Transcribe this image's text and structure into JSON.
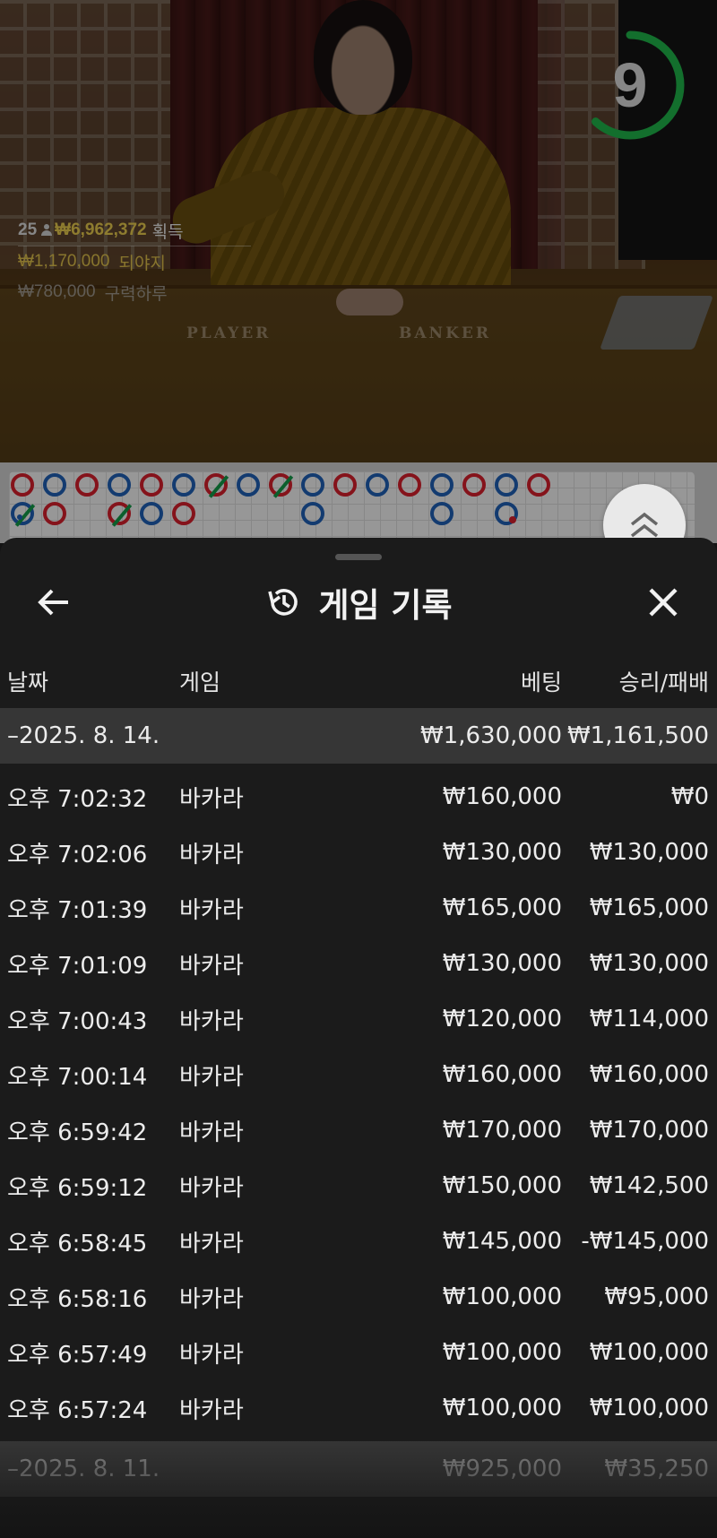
{
  "video": {
    "timer_value": "9",
    "timer_progress": 0.62,
    "table_labels": {
      "player": "PLAYER",
      "banker": "BANKER"
    },
    "winners": {
      "count": "25",
      "total_amount": "₩6,962,372",
      "total_label": "획득",
      "entries": [
        {
          "amount": "₩1,170,000",
          "name": "되야지"
        },
        {
          "amount": "₩780,000",
          "name": "구력하루"
        }
      ]
    },
    "colors": {
      "banker": "#d7202c",
      "player": "#1f5fb5",
      "tie": "#139a48",
      "timer_ring": "#1fb34a"
    }
  },
  "roadmap": {
    "rows": [
      [
        "B",
        "P",
        "B",
        "P",
        "B",
        "P",
        "B/",
        "P",
        "B/",
        "P",
        "B",
        "P",
        "B",
        "P",
        "B",
        "P",
        "B"
      ],
      [
        "P/",
        "B",
        null,
        "B/",
        "P",
        "B",
        null,
        null,
        null,
        "P",
        null,
        null,
        null,
        "P",
        null,
        "P.",
        null
      ]
    ],
    "expand_icon": "chevron-double-up-icon"
  },
  "sheet": {
    "back_icon": "arrow-left-icon",
    "title_icon": "history-icon",
    "title": "게임 기록",
    "close_icon": "close-icon",
    "columns": {
      "date": "날짜",
      "game": "게임",
      "bet": "베팅",
      "result": "승리/패배"
    },
    "groups": [
      {
        "date": "–2025. 8. 14.",
        "bet": "₩1,630,000",
        "result": "₩1,161,500",
        "rows": [
          {
            "time": "오후 7:02:32",
            "game": "바카라",
            "bet": "₩160,000",
            "result": "₩0"
          },
          {
            "time": "오후 7:02:06",
            "game": "바카라",
            "bet": "₩130,000",
            "result": "₩130,000"
          },
          {
            "time": "오후 7:01:39",
            "game": "바카라",
            "bet": "₩165,000",
            "result": "₩165,000"
          },
          {
            "time": "오후 7:01:09",
            "game": "바카라",
            "bet": "₩130,000",
            "result": "₩130,000"
          },
          {
            "time": "오후 7:00:43",
            "game": "바카라",
            "bet": "₩120,000",
            "result": "₩114,000"
          },
          {
            "time": "오후 7:00:14",
            "game": "바카라",
            "bet": "₩160,000",
            "result": "₩160,000"
          },
          {
            "time": "오후 6:59:42",
            "game": "바카라",
            "bet": "₩170,000",
            "result": "₩170,000"
          },
          {
            "time": "오후 6:59:12",
            "game": "바카라",
            "bet": "₩150,000",
            "result": "₩142,500"
          },
          {
            "time": "오후 6:58:45",
            "game": "바카라",
            "bet": "₩145,000",
            "result": "-₩145,000"
          },
          {
            "time": "오후 6:58:16",
            "game": "바카라",
            "bet": "₩100,000",
            "result": "₩95,000"
          },
          {
            "time": "오후 6:57:49",
            "game": "바카라",
            "bet": "₩100,000",
            "result": "₩100,000"
          },
          {
            "time": "오후 6:57:24",
            "game": "바카라",
            "bet": "₩100,000",
            "result": "₩100,000"
          }
        ]
      },
      {
        "date": "–2025. 8. 11.",
        "bet": "₩925,000",
        "result": "₩35,250",
        "rows": []
      }
    ]
  }
}
